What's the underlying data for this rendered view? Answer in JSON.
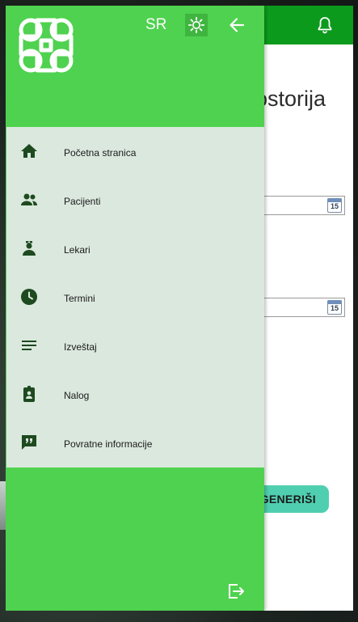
{
  "window": {
    "background_title": "rostorija",
    "generate_button_label": "GENERIŠI",
    "date_field_1_day": "15",
    "date_field_2_day": "15"
  },
  "drawer": {
    "language": "SR",
    "items": [
      {
        "label": "Početna stranica",
        "icon": "home-icon"
      },
      {
        "label": "Pacijenti",
        "icon": "people-icon"
      },
      {
        "label": "Lekari",
        "icon": "doctor-icon"
      },
      {
        "label": "Termini",
        "icon": "clock-icon"
      },
      {
        "label": "Izveštaj",
        "icon": "report-icon"
      },
      {
        "label": "Nalog",
        "icon": "account-badge-icon"
      },
      {
        "label": "Povratne informacije",
        "icon": "feedback-icon"
      }
    ]
  },
  "colors": {
    "header": "#0c9a1c",
    "drawer": "#4fd24f",
    "menu_background": "#dbe8de",
    "button": "#4fcfb0"
  }
}
